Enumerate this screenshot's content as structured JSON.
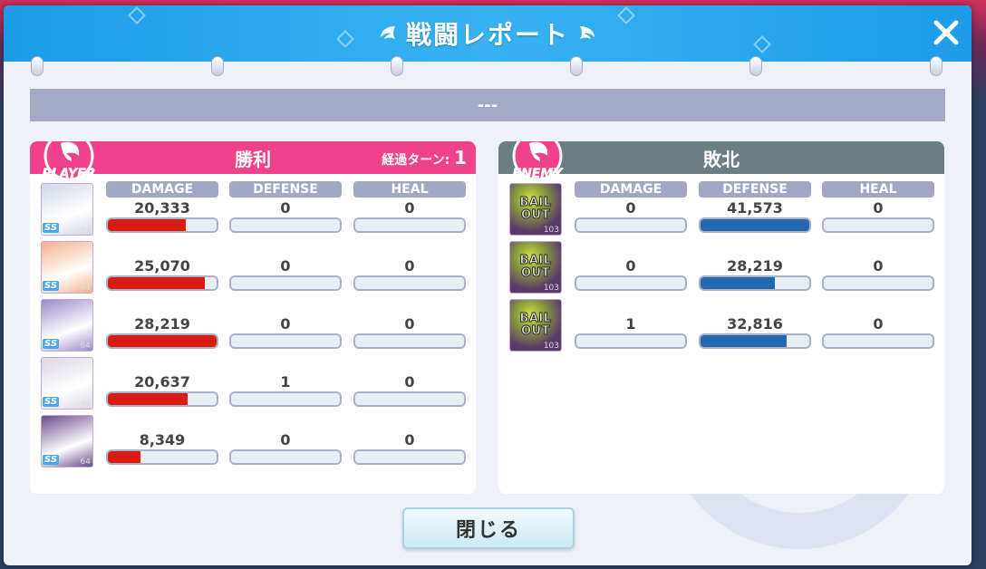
{
  "dialog": {
    "title": "戦闘レポート",
    "close_glyph": "✕",
    "subtitle": "---",
    "footer_button": "閉じる"
  },
  "player": {
    "badge": "PLAYER",
    "result": "勝利",
    "turn_label": "経過ターン:",
    "turn_value": "1",
    "headers": {
      "damage": "DAMAGE",
      "defense": "DEFENSE",
      "heal": "HEAL"
    },
    "rows": [
      {
        "damage": "20,333",
        "defense": "0",
        "heal": "0",
        "damage_ratio": 0.72,
        "defense_ratio": 0,
        "heal_ratio": 0,
        "portrait_color": "#cfd8e8",
        "level": "64",
        "star": "SS"
      },
      {
        "damage": "25,070",
        "defense": "0",
        "heal": "0",
        "damage_ratio": 0.89,
        "defense_ratio": 0,
        "heal_ratio": 0,
        "portrait_color": "#f2b08a",
        "level": "64",
        "star": "SS"
      },
      {
        "damage": "28,219",
        "defense": "0",
        "heal": "0",
        "damage_ratio": 1.0,
        "defense_ratio": 0,
        "heal_ratio": 0,
        "portrait_color": "#9a8ac8",
        "level": "64",
        "star": "SS"
      },
      {
        "damage": "20,637",
        "defense": "1",
        "heal": "0",
        "damage_ratio": 0.73,
        "defense_ratio": 0,
        "heal_ratio": 0,
        "portrait_color": "#dcd6e6",
        "level": "64",
        "star": "SS"
      },
      {
        "damage": "8,349",
        "defense": "0",
        "heal": "0",
        "damage_ratio": 0.3,
        "defense_ratio": 0,
        "heal_ratio": 0,
        "portrait_color": "#6a4a8a",
        "level": "64",
        "star": "SS"
      }
    ]
  },
  "enemy": {
    "badge": "ENEMY",
    "result": "敗北",
    "headers": {
      "damage": "DAMAGE",
      "defense": "DEFENSE",
      "heal": "HEAL"
    },
    "rows": [
      {
        "name_line1": "BAIL",
        "name_line2": "OUT",
        "level": "103",
        "damage": "0",
        "defense": "41,573",
        "heal": "0",
        "damage_ratio": 0,
        "defense_ratio": 1.0,
        "heal_ratio": 0
      },
      {
        "name_line1": "BAIL",
        "name_line2": "OUT",
        "level": "103",
        "damage": "0",
        "defense": "28,219",
        "heal": "0",
        "damage_ratio": 0,
        "defense_ratio": 0.68,
        "heal_ratio": 0
      },
      {
        "name_line1": "BAIL",
        "name_line2": "OUT",
        "level": "103",
        "damage": "1",
        "defense": "32,816",
        "heal": "0",
        "damage_ratio": 0,
        "defense_ratio": 0.79,
        "heal_ratio": 0
      }
    ]
  },
  "colors": {
    "player_accent": "#f0428a",
    "enemy_accent": "#6b7e82",
    "damage_fill": "#d81c10",
    "defense_fill": "#2468b0",
    "title_bar": "#1c9ce8"
  }
}
